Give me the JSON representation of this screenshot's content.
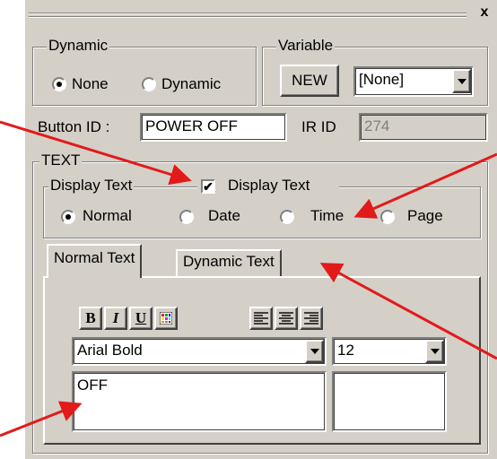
{
  "window": {
    "close_glyph": "x"
  },
  "dynamic_group": {
    "title": "Dynamic",
    "options": [
      {
        "label": "None",
        "selected": true
      },
      {
        "label": "Dynamic",
        "selected": false
      }
    ]
  },
  "variable_group": {
    "title": "Variable",
    "new_button_label": "NEW",
    "select_value": "[None]"
  },
  "button_id": {
    "label": "Button ID :",
    "value": "POWER OFF"
  },
  "ir_id": {
    "label": "IR ID",
    "value": "274"
  },
  "text_group": {
    "title": "TEXT",
    "display_text_group_title": "Display Text",
    "display_text_checkbox_label": "Display Text",
    "display_text_checked": true,
    "modes": [
      {
        "label": "Normal",
        "selected": true
      },
      {
        "label": "Date",
        "selected": false
      },
      {
        "label": "Time",
        "selected": false
      },
      {
        "label": "Page",
        "selected": false
      }
    ]
  },
  "tabs": [
    {
      "label": "Normal Text",
      "active": true
    },
    {
      "label": "Dynamic Text",
      "active": false
    }
  ],
  "format_toolbar": {
    "bold": "B",
    "italic": "I",
    "underline": "U"
  },
  "font": {
    "family": "Arial Bold",
    "size": "12"
  },
  "text_content": "OFF",
  "colors": {
    "panel": "#d4d0c8",
    "annotation_arrow": "#e21a1a"
  }
}
